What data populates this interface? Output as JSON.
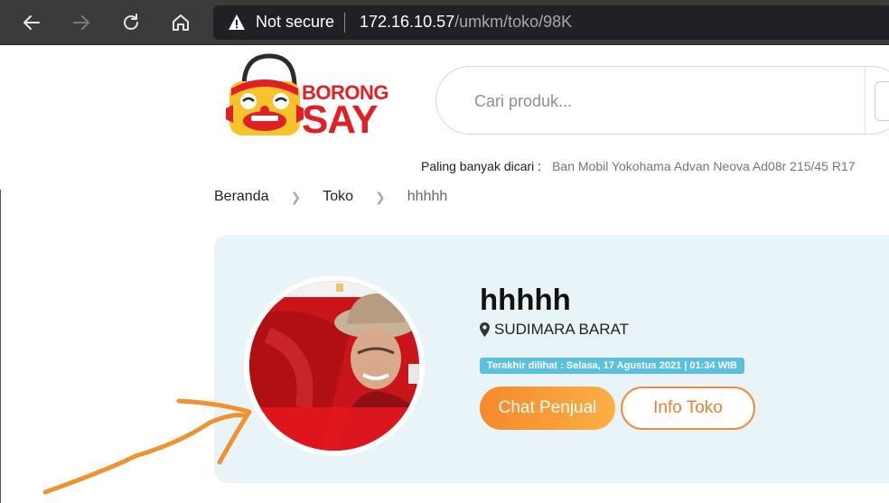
{
  "browser": {
    "security_label": "Not secure",
    "url_host": "172.16.10.57",
    "url_path": "/umkm/toko/98K"
  },
  "header": {
    "logo_line1": "BORONG",
    "logo_line2": "SAY",
    "search_placeholder": "Cari produk...",
    "popular_label": "Paling banyak dicari :",
    "popular_items": "Ban Mobil Yokohama Advan Neova Ad08r 215/45 R17"
  },
  "breadcrumb": {
    "items": [
      "Beranda",
      "Toko",
      "hhhhh"
    ]
  },
  "shop": {
    "name": "hhhhh",
    "location": "SUDIMARA BARAT",
    "last_seen": "Terakhir dilihat : Selasa, 17 Agustus 2021 | 01:34 WIB",
    "chat_label": "Chat Penjual",
    "info_label": "Info Toko"
  },
  "colors": {
    "accent_orange": "#f6892c",
    "badge_blue": "#5bc0de",
    "card_bg": "#e9f4f8",
    "logo_red": "#e01f26"
  }
}
